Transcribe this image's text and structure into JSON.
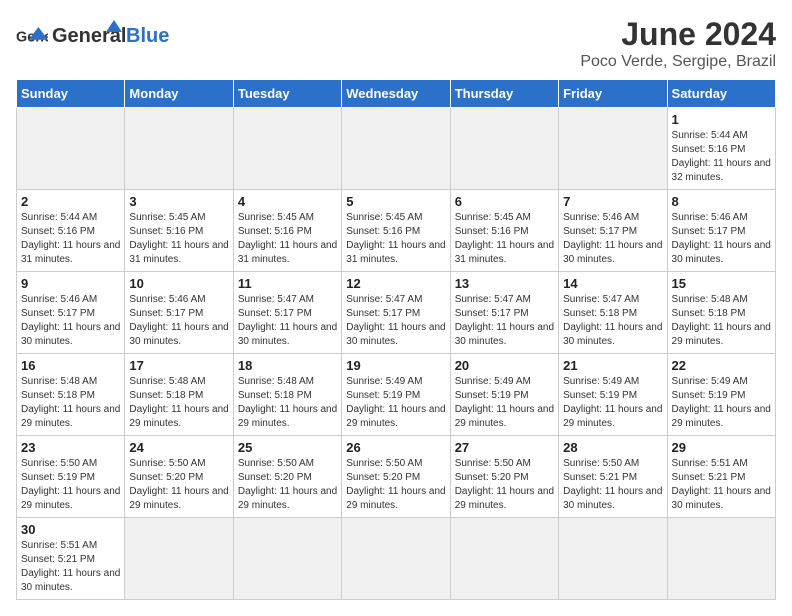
{
  "header": {
    "logo_general": "General",
    "logo_blue": "Blue",
    "month_title": "June 2024",
    "subtitle": "Poco Verde, Sergipe, Brazil"
  },
  "weekdays": [
    "Sunday",
    "Monday",
    "Tuesday",
    "Wednesday",
    "Thursday",
    "Friday",
    "Saturday"
  ],
  "weeks": [
    [
      {
        "day": "",
        "empty": true
      },
      {
        "day": "",
        "empty": true
      },
      {
        "day": "",
        "empty": true
      },
      {
        "day": "",
        "empty": true
      },
      {
        "day": "",
        "empty": true
      },
      {
        "day": "",
        "empty": true
      },
      {
        "day": "1",
        "sunrise": "5:44 AM",
        "sunset": "5:16 PM",
        "daylight": "11 hours and 32 minutes."
      }
    ],
    [
      {
        "day": "2",
        "sunrise": "5:44 AM",
        "sunset": "5:16 PM",
        "daylight": "11 hours and 31 minutes."
      },
      {
        "day": "3",
        "sunrise": "5:45 AM",
        "sunset": "5:16 PM",
        "daylight": "11 hours and 31 minutes."
      },
      {
        "day": "4",
        "sunrise": "5:45 AM",
        "sunset": "5:16 PM",
        "daylight": "11 hours and 31 minutes."
      },
      {
        "day": "5",
        "sunrise": "5:45 AM",
        "sunset": "5:16 PM",
        "daylight": "11 hours and 31 minutes."
      },
      {
        "day": "6",
        "sunrise": "5:45 AM",
        "sunset": "5:16 PM",
        "daylight": "11 hours and 31 minutes."
      },
      {
        "day": "7",
        "sunrise": "5:46 AM",
        "sunset": "5:17 PM",
        "daylight": "11 hours and 30 minutes."
      },
      {
        "day": "8",
        "sunrise": "5:46 AM",
        "sunset": "5:17 PM",
        "daylight": "11 hours and 30 minutes."
      }
    ],
    [
      {
        "day": "9",
        "sunrise": "5:46 AM",
        "sunset": "5:17 PM",
        "daylight": "11 hours and 30 minutes."
      },
      {
        "day": "10",
        "sunrise": "5:46 AM",
        "sunset": "5:17 PM",
        "daylight": "11 hours and 30 minutes."
      },
      {
        "day": "11",
        "sunrise": "5:47 AM",
        "sunset": "5:17 PM",
        "daylight": "11 hours and 30 minutes."
      },
      {
        "day": "12",
        "sunrise": "5:47 AM",
        "sunset": "5:17 PM",
        "daylight": "11 hours and 30 minutes."
      },
      {
        "day": "13",
        "sunrise": "5:47 AM",
        "sunset": "5:17 PM",
        "daylight": "11 hours and 30 minutes."
      },
      {
        "day": "14",
        "sunrise": "5:47 AM",
        "sunset": "5:18 PM",
        "daylight": "11 hours and 30 minutes."
      },
      {
        "day": "15",
        "sunrise": "5:48 AM",
        "sunset": "5:18 PM",
        "daylight": "11 hours and 29 minutes."
      }
    ],
    [
      {
        "day": "16",
        "sunrise": "5:48 AM",
        "sunset": "5:18 PM",
        "daylight": "11 hours and 29 minutes."
      },
      {
        "day": "17",
        "sunrise": "5:48 AM",
        "sunset": "5:18 PM",
        "daylight": "11 hours and 29 minutes."
      },
      {
        "day": "18",
        "sunrise": "5:48 AM",
        "sunset": "5:18 PM",
        "daylight": "11 hours and 29 minutes."
      },
      {
        "day": "19",
        "sunrise": "5:49 AM",
        "sunset": "5:19 PM",
        "daylight": "11 hours and 29 minutes."
      },
      {
        "day": "20",
        "sunrise": "5:49 AM",
        "sunset": "5:19 PM",
        "daylight": "11 hours and 29 minutes."
      },
      {
        "day": "21",
        "sunrise": "5:49 AM",
        "sunset": "5:19 PM",
        "daylight": "11 hours and 29 minutes."
      },
      {
        "day": "22",
        "sunrise": "5:49 AM",
        "sunset": "5:19 PM",
        "daylight": "11 hours and 29 minutes."
      }
    ],
    [
      {
        "day": "23",
        "sunrise": "5:50 AM",
        "sunset": "5:19 PM",
        "daylight": "11 hours and 29 minutes."
      },
      {
        "day": "24",
        "sunrise": "5:50 AM",
        "sunset": "5:20 PM",
        "daylight": "11 hours and 29 minutes."
      },
      {
        "day": "25",
        "sunrise": "5:50 AM",
        "sunset": "5:20 PM",
        "daylight": "11 hours and 29 minutes."
      },
      {
        "day": "26",
        "sunrise": "5:50 AM",
        "sunset": "5:20 PM",
        "daylight": "11 hours and 29 minutes."
      },
      {
        "day": "27",
        "sunrise": "5:50 AM",
        "sunset": "5:20 PM",
        "daylight": "11 hours and 29 minutes."
      },
      {
        "day": "28",
        "sunrise": "5:50 AM",
        "sunset": "5:21 PM",
        "daylight": "11 hours and 30 minutes."
      },
      {
        "day": "29",
        "sunrise": "5:51 AM",
        "sunset": "5:21 PM",
        "daylight": "11 hours and 30 minutes."
      }
    ],
    [
      {
        "day": "30",
        "sunrise": "5:51 AM",
        "sunset": "5:21 PM",
        "daylight": "11 hours and 30 minutes."
      },
      {
        "day": "",
        "empty": true
      },
      {
        "day": "",
        "empty": true
      },
      {
        "day": "",
        "empty": true
      },
      {
        "day": "",
        "empty": true
      },
      {
        "day": "",
        "empty": true
      },
      {
        "day": "",
        "empty": true
      }
    ]
  ],
  "labels": {
    "sunrise": "Sunrise:",
    "sunset": "Sunset:",
    "daylight": "Daylight:"
  }
}
